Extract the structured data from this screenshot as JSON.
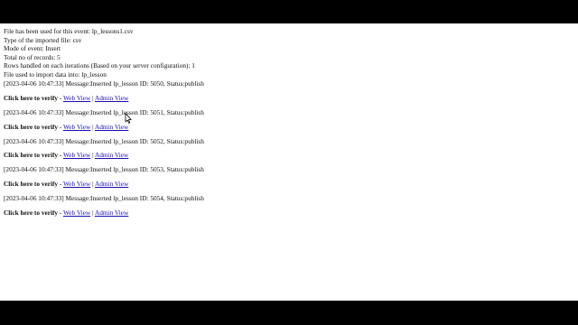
{
  "header_lines": [
    "File has been used for this event: lp_lessons1.csv",
    "Type of the imported file: csv",
    "Mode of event: Insert",
    "Total no of records: 5",
    "Rows handled on each iterations (Based on your server configuration): 1",
    "File used to import data into: lp_lesson"
  ],
  "verify_label": "Click here to verify",
  "verify_dash": " - ",
  "separator": "|",
  "web_view_label": "Web View",
  "admin_view_label": "Admin View",
  "log_entries": [
    "[2023-04-06 10:47:33] Message:Inserted lp_lesson ID: 5050, Status:publish",
    "[2023-04-06 10:47:33] Message:Inserted lp_lesson ID: 5051, Status:publish",
    "[2023-04-06 10:47:33] Message:Inserted lp_lesson ID: 5052, Status:publish",
    "[2023-04-06 10:47:33] Message:Inserted lp_lesson ID: 5053, Status:publish",
    "[2023-04-06 10:47:33] Message:Inserted lp_lesson ID: 5054, Status:publish"
  ],
  "colors": {
    "link": "#1a0dab",
    "text": "#111111",
    "letterbox": "#000000"
  }
}
